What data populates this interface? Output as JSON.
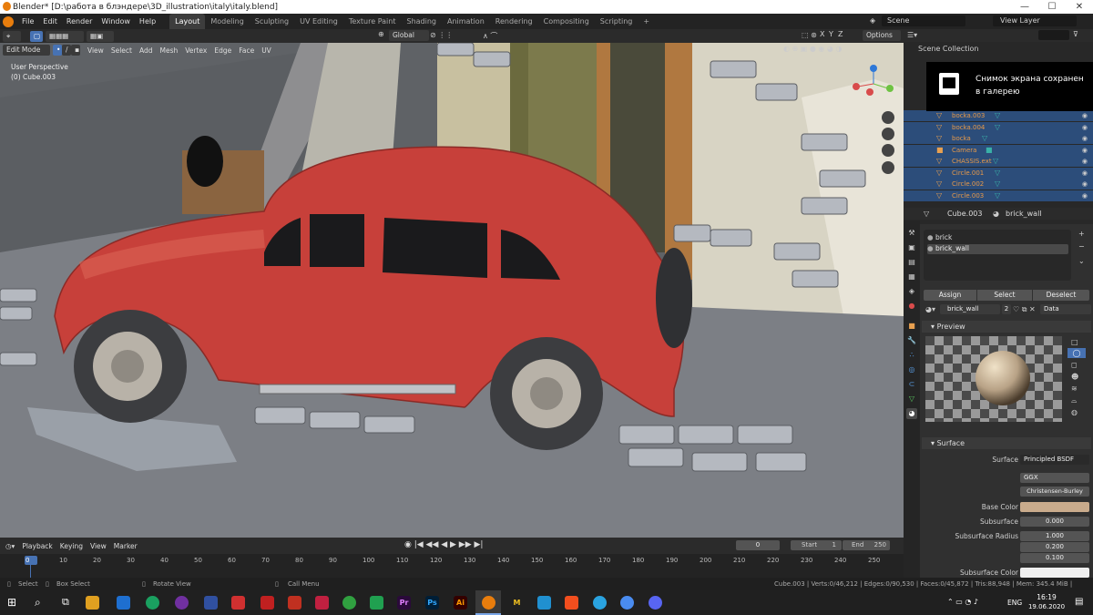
{
  "window": {
    "title": "Blender* [D:\\работа в блэндере\\3D_illustration\\italy\\italy.blend]",
    "minimize": "—",
    "maximize": "☐",
    "close": "✕"
  },
  "menu": {
    "items": [
      "File",
      "Edit",
      "Render",
      "Window",
      "Help"
    ]
  },
  "workspaces": [
    "Layout",
    "Modeling",
    "Sculpting",
    "UV Editing",
    "Texture Paint",
    "Shading",
    "Animation",
    "Rendering",
    "Compositing",
    "Scripting"
  ],
  "add_workspace": "+",
  "scene": {
    "label": "Scene",
    "view_layer": "View Layer"
  },
  "viewport_header": {
    "mode": "Edit Mode",
    "menus": [
      "View",
      "Select",
      "Add",
      "Mesh",
      "Vertex",
      "Edge",
      "Face",
      "UV"
    ],
    "orientation": "Global",
    "axes": [
      "X",
      "Y",
      "Z"
    ],
    "options": "Options"
  },
  "viewport": {
    "perspective": "User Perspective",
    "object": "(0) Cube.003"
  },
  "outliner": {
    "title": "Scene Collection",
    "rows": [
      {
        "name": "bocka.003"
      },
      {
        "name": "bocka.004"
      },
      {
        "name": "bocka"
      },
      {
        "name": "Camera"
      },
      {
        "name": "CHASSIS.ext"
      },
      {
        "name": "Circle.001"
      },
      {
        "name": "Circle.002"
      },
      {
        "name": "Circle.003"
      }
    ]
  },
  "toast": {
    "line1": "Снимок экрана сохранен",
    "line2": "в галерею"
  },
  "properties": {
    "object": "Cube.003",
    "material": "brick_wall",
    "slots": [
      "brick",
      "brick_wall"
    ],
    "slot_buttons": [
      "Assign",
      "Select",
      "Deselect"
    ],
    "material_field": "brick_wall",
    "user_count": "2",
    "link": "Data",
    "preview_label": "Preview",
    "surface_label": "Surface",
    "surface_rows": [
      {
        "label": "Surface",
        "value": "Principled BSDF"
      },
      {
        "label": "",
        "value": "GGX"
      },
      {
        "label": "",
        "value": "Christensen-Burley"
      },
      {
        "label": "Base Color",
        "value": ""
      },
      {
        "label": "Subsurface",
        "value": "0.000"
      },
      {
        "label": "Subsurface Radius",
        "value": "1.000"
      },
      {
        "label": "",
        "value": "0.200"
      },
      {
        "label": "",
        "value": "0.100"
      },
      {
        "label": "Subsurface Color",
        "value": ""
      }
    ],
    "base_color": "#c9ab8c",
    "subsurface_color": "#efefef"
  },
  "timeline": {
    "menus": [
      "Playback",
      "Keying",
      "View",
      "Marker"
    ],
    "current_frame": "0",
    "start_label": "Start",
    "start": "1",
    "end_label": "End",
    "end": "250",
    "ticks": [
      "0",
      "10",
      "20",
      "30",
      "40",
      "50",
      "60",
      "70",
      "80",
      "90",
      "100",
      "110",
      "120",
      "130",
      "140",
      "150",
      "160",
      "170",
      "180",
      "190",
      "200",
      "210",
      "220",
      "230",
      "240",
      "250"
    ]
  },
  "status": {
    "select": "Select",
    "box_select": "Box Select",
    "rotate": "Rotate View",
    "call_menu": "Call Menu",
    "stats": "Cube.003 | Verts:0/46,212 | Edges:0/90,530 | Faces:0/45,872 | Tris:88,948 | Mem: 345.4 MiB | v2.81.16"
  },
  "taskbar": {
    "lang": "ENG",
    "time": "16:19",
    "date": "19.06.2020",
    "apps": [
      "Pr",
      "Ps",
      "Ai",
      "M"
    ]
  },
  "colors": {
    "accent": "#4772b3",
    "car": "#c7403a",
    "selected_row": "#2c4d7a"
  }
}
